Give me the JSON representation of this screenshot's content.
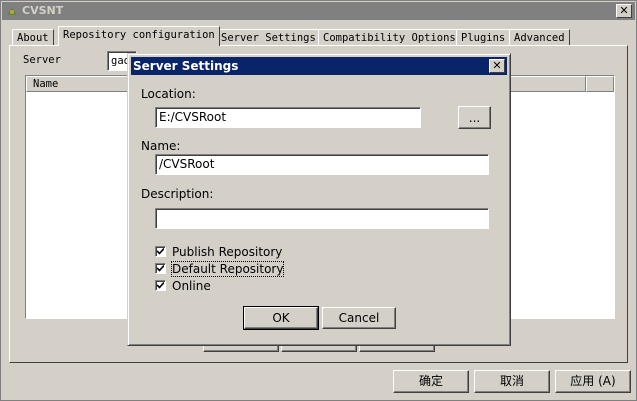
{
  "window": {
    "title": "CVSNT",
    "close_glyph": "✕"
  },
  "tabs": [
    {
      "label": "About"
    },
    {
      "label": "Repository configuration"
    },
    {
      "label": "Server Settings"
    },
    {
      "label": "Compatibility Options"
    },
    {
      "label": "Plugins"
    },
    {
      "label": "Advanced"
    }
  ],
  "repository_panel": {
    "server_label": "Server",
    "server_value": "gao",
    "list_columns": [
      "Name"
    ]
  },
  "footer_buttons": {
    "ok": "确定",
    "cancel": "取消",
    "apply": "应用",
    "apply_accel": "(A)"
  },
  "dialog": {
    "title": "Server Settings",
    "close_glyph": "✕",
    "location_label": "Location:",
    "location_value": "E:/CVSRoot",
    "browse_label": "...",
    "name_label": "Name:",
    "name_value": "/CVSRoot",
    "description_label": "Description:",
    "description_value": "",
    "checkboxes": [
      {
        "label": "Publish Repository",
        "checked": true
      },
      {
        "label": "Default Repository",
        "checked": true
      },
      {
        "label": "Online",
        "checked": true
      }
    ],
    "ok_label": "OK",
    "cancel_label": "Cancel"
  }
}
